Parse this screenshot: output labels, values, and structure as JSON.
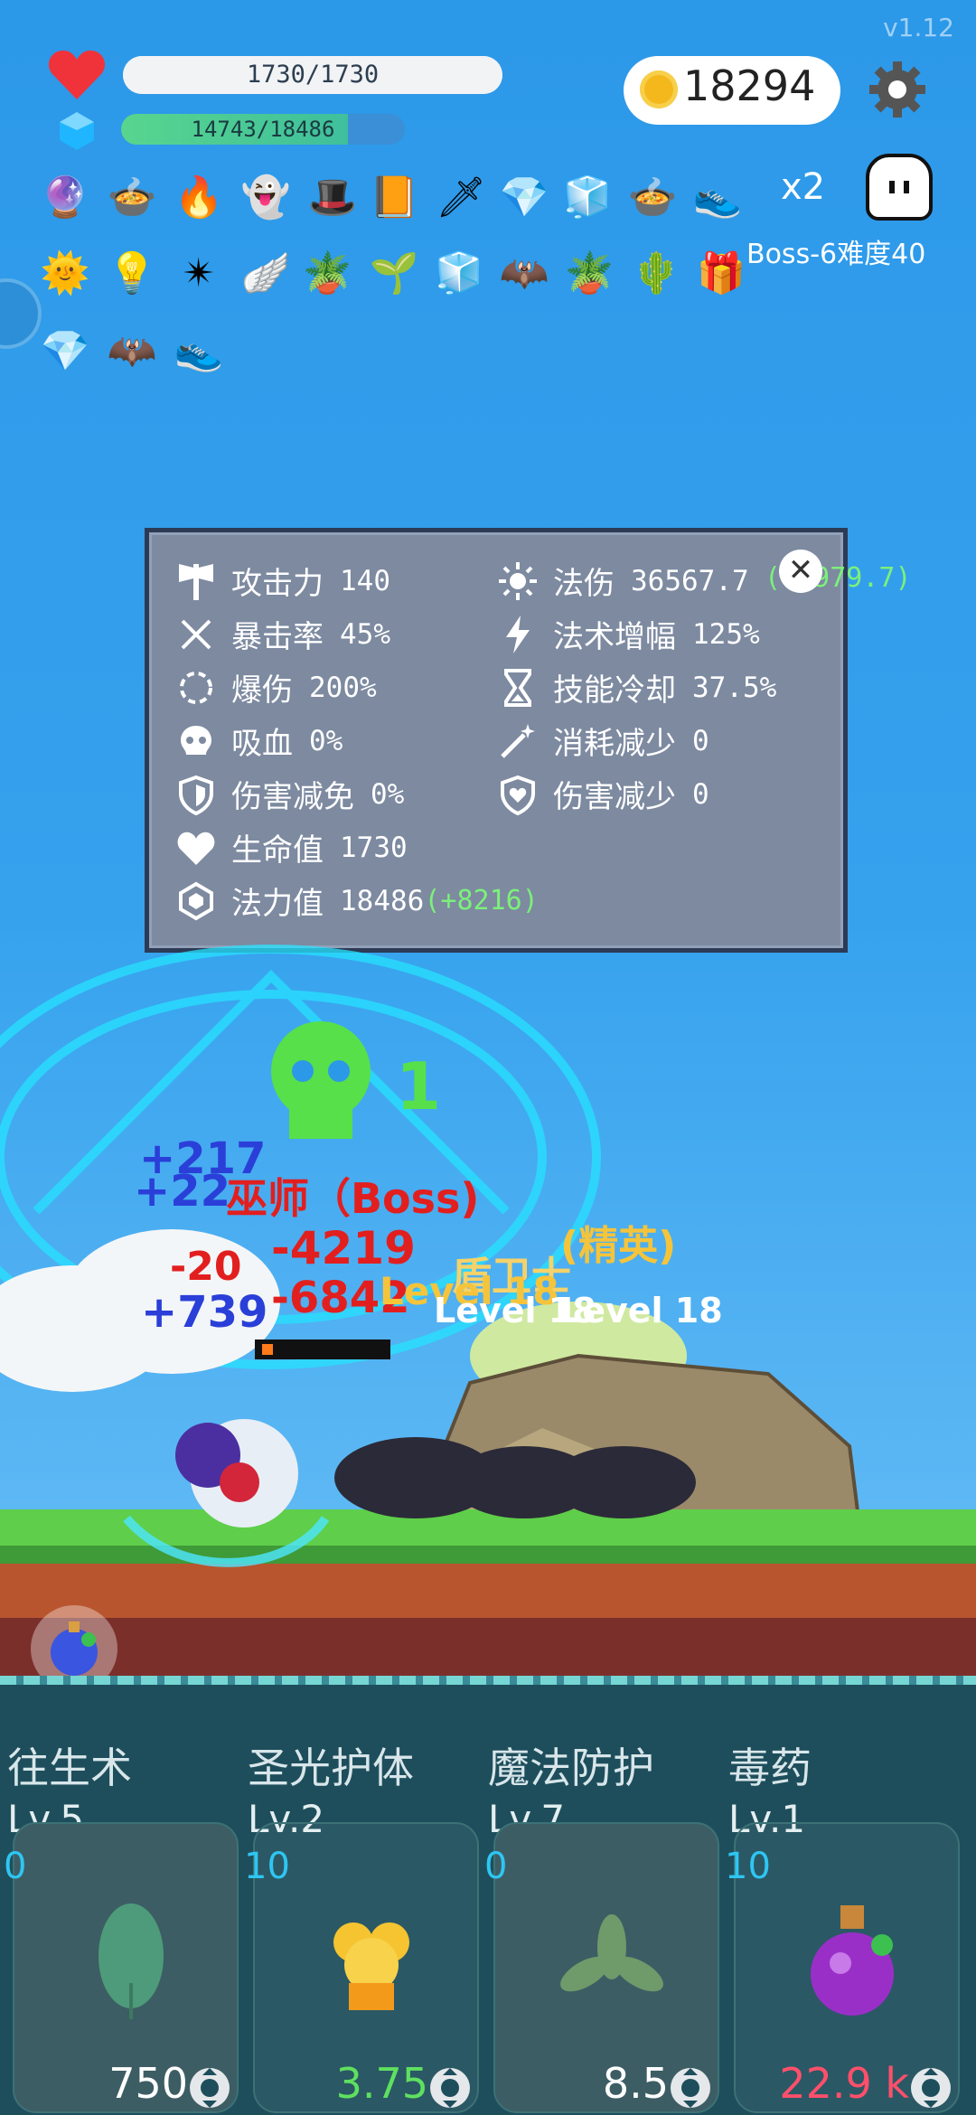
{
  "version": "v1.12",
  "player": {
    "hp_text": "1730/1730",
    "mp_text": "14743/18486",
    "mp_fraction": 0.8
  },
  "coins": "18294",
  "multiplier": "x2",
  "boss_label": "Boss-6难度40",
  "items_row1": [
    "crystal-ball",
    "black-cauldron",
    "flame-torch",
    "green-spirit",
    "wizard-hat",
    "spell-book",
    "sword",
    "blue-diamond",
    "ice-cube",
    "black-cauldron",
    "red-sneaker"
  ],
  "items_row2": [
    "sun-orb",
    "light-bulb",
    "spike-ball",
    "angel-wing",
    "potted-plant",
    "sapling",
    "ice-cube",
    "bat",
    "potted-plant",
    "spiked-club",
    "gift-box"
  ],
  "items_row3": [
    "blue-diamond",
    "bat",
    "red-sneaker"
  ],
  "stats": {
    "attack": {
      "label": "攻击力",
      "value": "140"
    },
    "crit_rate": {
      "label": "暴击率",
      "value": "45%"
    },
    "crit_damage": {
      "label": "爆伤",
      "value": "200%"
    },
    "lifesteal": {
      "label": "吸血",
      "value": "0%"
    },
    "damage_immunity": {
      "label": "伤害减免",
      "value": "0%"
    },
    "hp": {
      "label": "生命值",
      "value": "1730"
    },
    "mana": {
      "label": "法力值",
      "value": "18486",
      "bonus": "(+8216)"
    },
    "spell_damage": {
      "label": "法伤",
      "value": "36567.7",
      "bonus": "(+4979.7)"
    },
    "spell_amp": {
      "label": "法术增幅",
      "value": "125%"
    },
    "cooldown": {
      "label": "技能冷却",
      "value": "37.5%"
    },
    "cost_reduce": {
      "label": "消耗减少",
      "value": "0"
    },
    "damage_reduce": {
      "label": "伤害减少",
      "value": "0"
    }
  },
  "battle": {
    "skull_count": "1",
    "texts": {
      "t1": "+217",
      "t2": "+22",
      "t3": "巫师（Boss)",
      "t4": "-4219",
      "t5": "-20",
      "t6": "-6842",
      "t7": "盾卫士",
      "t8": "(精英)",
      "t9": "Level 18",
      "t10": "+739",
      "t11": "Level 18",
      "t12": "Level 18"
    }
  },
  "skills": [
    {
      "name": "往生术",
      "level": "Lv.5",
      "count": "0",
      "cost": "750",
      "cost_color": "#ffffff",
      "art": "leaf"
    },
    {
      "name": "圣光护体",
      "level": "Lv.2",
      "count": "10",
      "cost": "3.75",
      "cost_color": "#5fe05f",
      "art": "holy"
    },
    {
      "name": "魔法防护",
      "level": "Lv.7",
      "count": "0",
      "cost": "8.5",
      "cost_color": "#ffffff",
      "art": "herb"
    },
    {
      "name": "毒药",
      "level": "Lv.1",
      "count": "10",
      "cost": "22.9 k",
      "cost_color": "#ff4f6a",
      "art": "potion"
    }
  ]
}
